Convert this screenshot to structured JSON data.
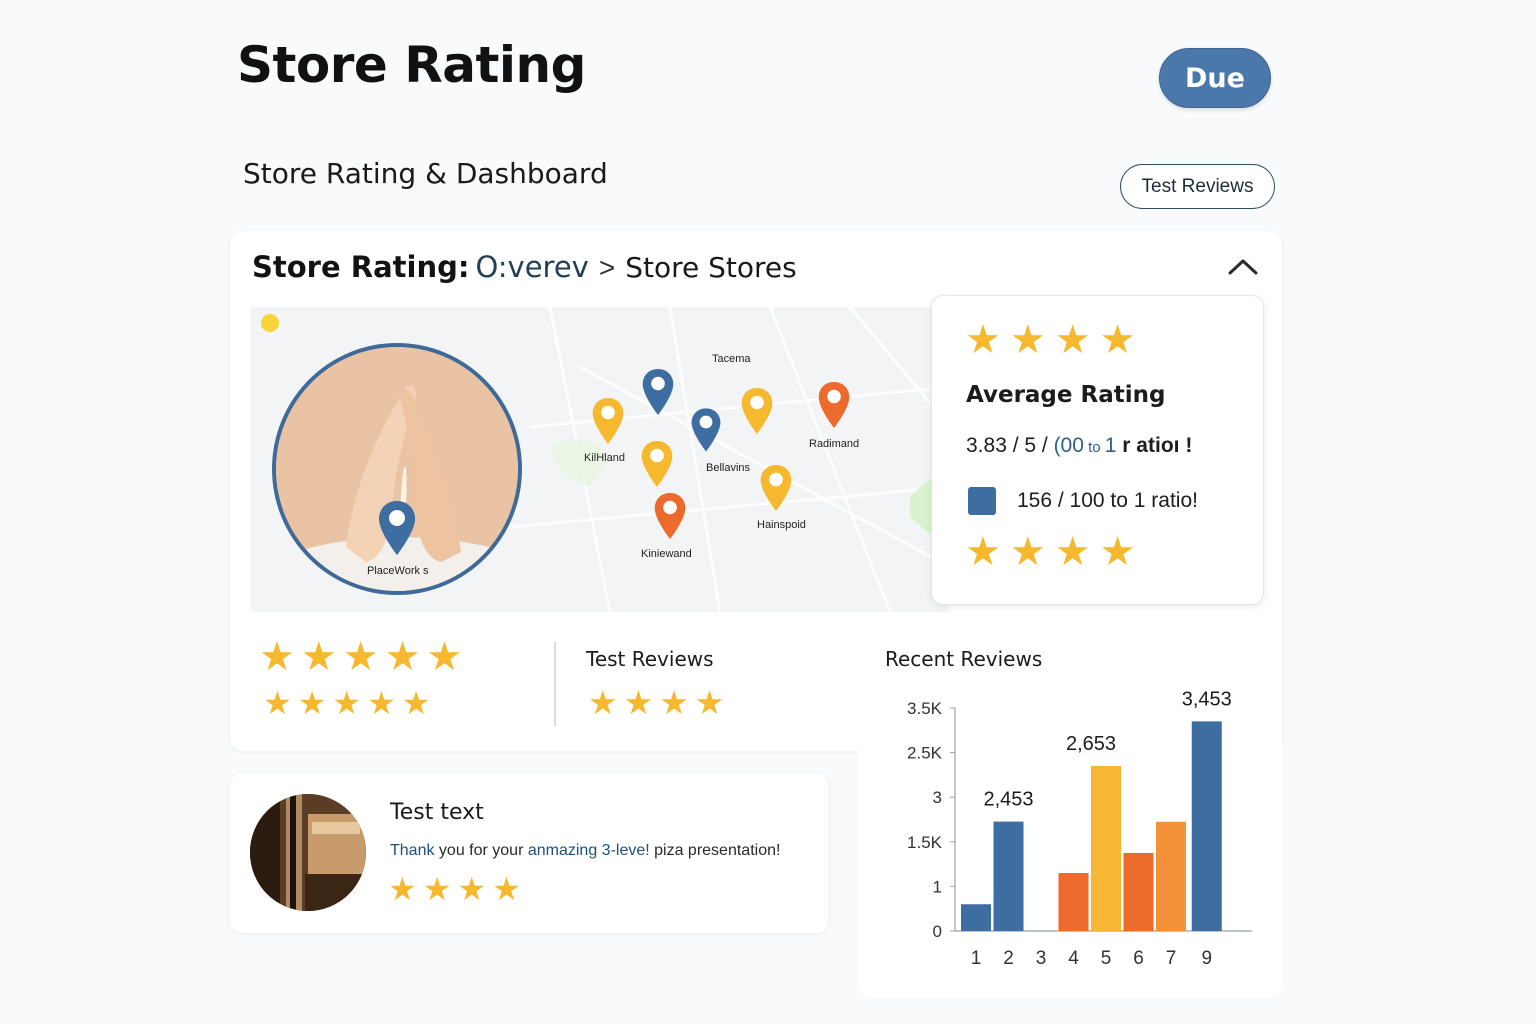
{
  "header": {
    "title": "Store Rating",
    "due_label": "Due",
    "subtitle": "Store Rating & Dashboard",
    "test_reviews_label": "Test Reviews"
  },
  "card": {
    "breadcrumb_bold": "Store Rating:",
    "breadcrumb_mid": "O:verev",
    "breadcrumb_chevron": ">",
    "breadcrumb_last": "Store Stores",
    "collapse_icon": "chevron-up-icon"
  },
  "map": {
    "labels": {
      "placeworks": "PlaceWork s",
      "kilhland": "KilHland",
      "tacema": "Tacema",
      "bellavins": "Bellavins",
      "radimand": "Radimand",
      "hainspoid": "Hainspoid",
      "kiniewand": "Kiniewand"
    },
    "colors": {
      "blue": "#3e6da1",
      "yellow": "#f5b82e",
      "orange": "#ec6a2c"
    }
  },
  "rating_panel": {
    "star_count_top": 4,
    "title": "Average Rating",
    "value_part1": "3.83 / 5 / ",
    "value_part2": "(00",
    "value_part3": " to ",
    "value_part4": "1",
    "value_part5": " r atioı !",
    "legend_text": "156 / 100 to 1 ratio!",
    "star_count_bottom": 4
  },
  "summary": {
    "stars_row1": 5,
    "stars_row2": 5,
    "test_reviews_label": "Test Reviews",
    "test_reviews_stars": 4,
    "recent_reviews_label": "Recent Reviews"
  },
  "review": {
    "title": "Test text",
    "body_1": "Thank",
    "body_2": " you for your ",
    "body_3": "anmazing 3-leve!",
    "body_4": " piza presentation!",
    "stars": 4
  },
  "chart_data": {
    "type": "bar",
    "title": "Recent Reviews",
    "y_tick_labels": [
      "0",
      "1",
      "1.5K",
      "3",
      "2.5K",
      "3.5K"
    ],
    "x_tick_labels": [
      "1",
      "2",
      "3",
      "4",
      "5",
      "6",
      "7",
      "9"
    ],
    "bars": [
      {
        "category": "1",
        "value": 0.6,
        "color": "#3e6da1"
      },
      {
        "category": "2",
        "value": 2.453,
        "color": "#3e6da1",
        "label": "2,453"
      },
      {
        "category": "4",
        "value": 1.3,
        "color": "#ec6a2c"
      },
      {
        "category": "5",
        "value": 3.7,
        "color": "#f7b935",
        "label": "2,653"
      },
      {
        "category": "6",
        "value": 1.75,
        "color": "#ec6a2c"
      },
      {
        "category": "7",
        "value": 2.45,
        "color": "#f4923a"
      },
      {
        "category": "9",
        "value": 4.7,
        "color": "#3e6da1",
        "label": "3,453"
      }
    ],
    "ylim": [
      0,
      5
    ]
  }
}
